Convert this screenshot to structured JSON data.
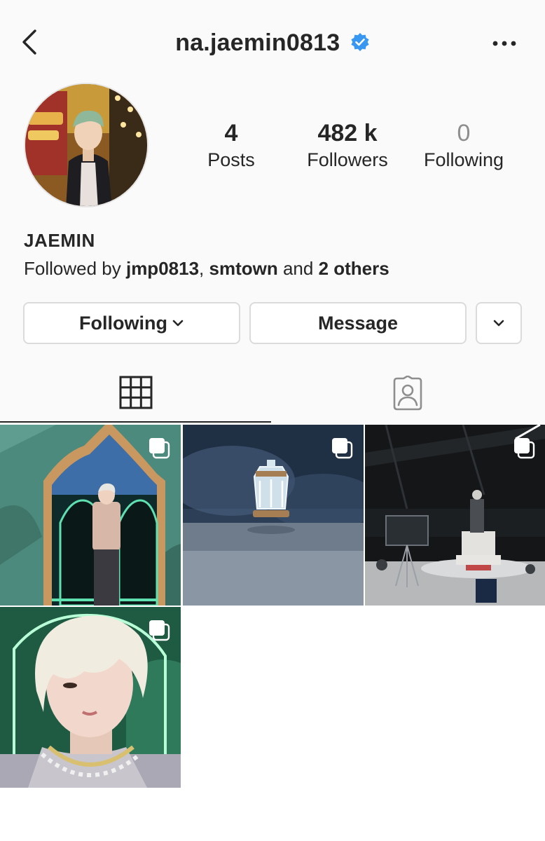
{
  "header": {
    "username": "na.jaemin0813",
    "back_icon": "chevron-left-icon",
    "verified_icon": "verified-badge-icon",
    "more_icon": "more-horizontal-icon"
  },
  "profile": {
    "display_name": "JAEMIN",
    "stats": [
      {
        "value": "4",
        "label": "Posts"
      },
      {
        "value": "482 k",
        "label": "Followers"
      },
      {
        "value": "0",
        "label": "Following"
      }
    ],
    "followed_by": {
      "prefix": "Followed by ",
      "user1": "jmp0813",
      "separator": ", ",
      "user2": "smtown",
      "middle": " and ",
      "others": "2 others"
    }
  },
  "actions": {
    "following_label": "Following",
    "message_label": "Message"
  },
  "tabs": {
    "grid_icon": "grid-icon",
    "tagged_icon": "tagged-person-icon"
  },
  "colors": {
    "verified": "#3897f0",
    "text": "#262626",
    "muted": "#8e8e8e",
    "border": "#dbdbdb"
  }
}
